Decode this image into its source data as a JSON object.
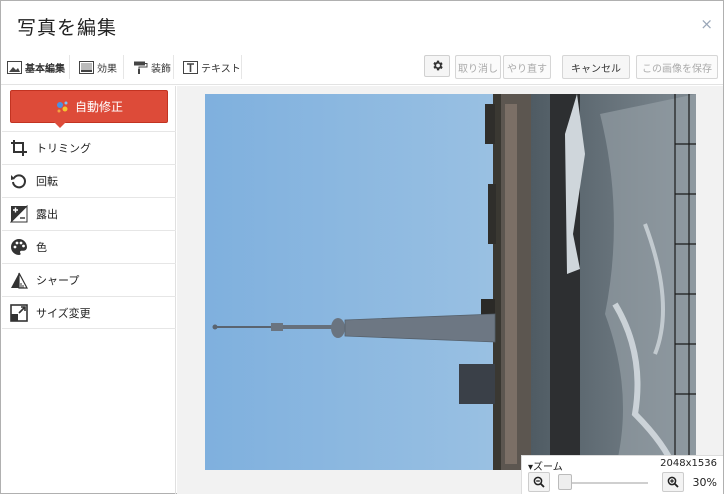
{
  "dialog": {
    "title": "写真を編集",
    "close_glyph": "×"
  },
  "toolbar": {
    "tabs": [
      {
        "label": "基本編集",
        "icon": "image-icon",
        "selected": true
      },
      {
        "label": "効果",
        "icon": "effects-icon",
        "selected": false
      },
      {
        "label": "装飾",
        "icon": "paint-roller-icon",
        "selected": false
      },
      {
        "label": "テキスト",
        "icon": "text-icon",
        "selected": false
      }
    ],
    "settings_icon": "gear-icon",
    "undo_label": "取り消し",
    "redo_label": "やり直す",
    "cancel_label": "キャンセル",
    "save_label": "この画像を保存"
  },
  "sidebar": {
    "autofix_label": "自動修正",
    "items": [
      {
        "label": "トリミング",
        "icon": "crop-icon"
      },
      {
        "label": "回転",
        "icon": "rotate-icon"
      },
      {
        "label": "露出",
        "icon": "exposure-icon"
      },
      {
        "label": "色",
        "icon": "palette-icon"
      },
      {
        "label": "シャープ",
        "icon": "sharpen-icon"
      },
      {
        "label": "サイズ変更",
        "icon": "resize-icon"
      }
    ]
  },
  "zoom": {
    "label": "▾ズーム",
    "dimensions": "2048x1536",
    "percent": "30%",
    "level": 0.0
  },
  "colors": {
    "autofix_bg": "#dd4b39",
    "sky": "#8fb6de",
    "icon_gray": "#444444"
  }
}
